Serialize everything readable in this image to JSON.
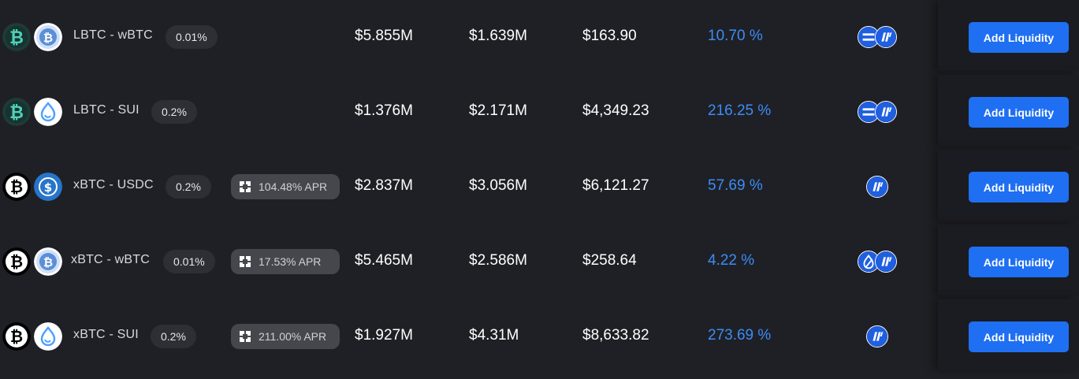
{
  "colors": {
    "background": "#1f2025",
    "accent_blue": "#1f6ff2",
    "apr_text": "#3b8df7",
    "lbtc_teal": "#4fd1b8"
  },
  "rows": [
    {
      "token_a_icon": "lbtc-icon",
      "token_b_icon": "wbtc-icon",
      "pair": "LBTC - wBTC",
      "fee": "0.01%",
      "incentive_apr": null,
      "tvl": "$5.855M",
      "volume": "$1.639M",
      "fees": "$163.90",
      "apr": "10.70 %",
      "protocols": [
        "equal-protocol-icon",
        "momentum-protocol-icon"
      ],
      "action": "Add Liquidity"
    },
    {
      "token_a_icon": "lbtc-icon",
      "token_b_icon": "sui-icon",
      "pair": "LBTC - SUI",
      "fee": "0.2%",
      "incentive_apr": null,
      "tvl": "$1.376M",
      "volume": "$2.171M",
      "fees": "$4,349.23",
      "apr": "216.25 %",
      "protocols": [
        "equal-protocol-icon",
        "momentum-protocol-icon"
      ],
      "action": "Add Liquidity"
    },
    {
      "token_a_icon": "xbtc-icon",
      "token_b_icon": "usdc-icon",
      "pair": "xBTC - USDC",
      "fee": "0.2%",
      "incentive_apr": "104.48% APR",
      "tvl": "$2.837M",
      "volume": "$3.056M",
      "fees": "$6,121.27",
      "apr": "57.69 %",
      "protocols": [
        "momentum-protocol-icon"
      ],
      "action": "Add Liquidity"
    },
    {
      "token_a_icon": "xbtc-icon",
      "token_b_icon": "wbtc-icon",
      "pair": "xBTC - wBTC",
      "fee": "0.01%",
      "incentive_apr": "17.53% APR",
      "tvl": "$5.465M",
      "volume": "$2.586M",
      "fees": "$258.64",
      "apr": "4.22 %",
      "protocols": [
        "sui-drop-protocol-icon",
        "momentum-protocol-icon"
      ],
      "action": "Add Liquidity"
    },
    {
      "token_a_icon": "xbtc-icon",
      "token_b_icon": "sui-icon",
      "pair": "xBTC - SUI",
      "fee": "0.2%",
      "incentive_apr": "211.00% APR",
      "tvl": "$1.927M",
      "volume": "$4.31M",
      "fees": "$8,633.82",
      "apr": "273.69 %",
      "protocols": [
        "momentum-protocol-icon"
      ],
      "action": "Add Liquidity"
    }
  ]
}
